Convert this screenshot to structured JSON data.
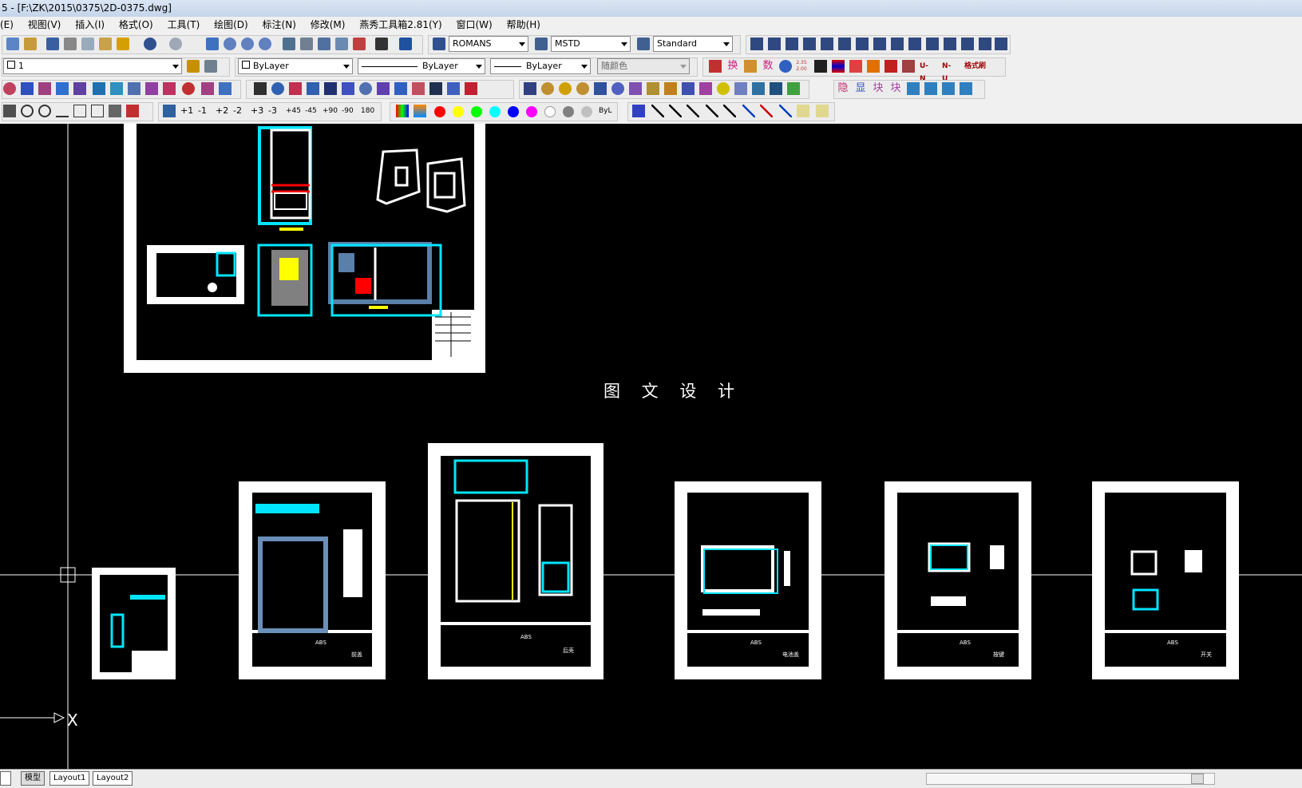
{
  "window": {
    "title": "5 - [F:\\ZK\\2015\\0375\\2D-0375.dwg]"
  },
  "menu": [
    "(E)",
    "视图(V)",
    "插入(I)",
    "格式(O)",
    "工具(T)",
    "绘图(D)",
    "标注(N)",
    "修改(M)",
    "燕秀工具箱2.81(Y)",
    "窗口(W)",
    "帮助(H)"
  ],
  "toolbar": {
    "text_style": "ROMANS",
    "dim_style": "MSTD",
    "table_style": "Standard",
    "layer": "1",
    "color": "ByLayer",
    "linetype": "ByLayer",
    "lineweight": "ByLayer",
    "plot_style": "随颜色",
    "row3_labels": [
      "换",
      "数",
      "2.35 2.00",
      "隐",
      "显",
      "块",
      "块",
      "U-N",
      "N-U",
      "格式刷"
    ],
    "row4_labels": [
      "+1",
      "-1",
      "+2",
      "-2",
      "+3",
      "-3",
      "+45",
      "-45",
      "+90",
      "-90",
      "180",
      "ByL"
    ],
    "palette": [
      "#ff0000",
      "#ffff00",
      "#00ff00",
      "#00ffff",
      "#0000ff",
      "#ff00ff",
      "#ffffff",
      "#808080",
      "#c0c0c0"
    ]
  },
  "drawing": {
    "banner": "图 文 设 计",
    "sheet_labels": [
      "ABS",
      "前盖",
      "ABS",
      "后壳",
      "ABS",
      "电池盖",
      "ABS",
      "按键",
      "ABS",
      "开关"
    ]
  },
  "tabs": [
    "模型",
    "Layout1",
    "Layout2"
  ]
}
